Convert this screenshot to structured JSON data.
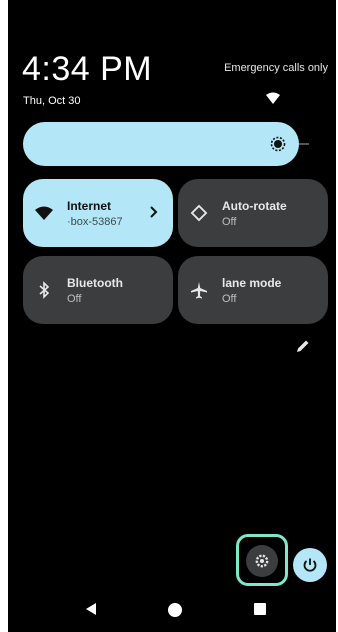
{
  "status": {
    "time": "4:34 PM",
    "date": "Thu, Oct 30",
    "network_text": "Emergency calls only"
  },
  "brightness": {
    "icon": "brightness-icon"
  },
  "tiles": [
    {
      "label": "Internet",
      "sublabel": "·box-53867",
      "icon": "wifi-icon",
      "active": true
    },
    {
      "label": "Auto-rotate",
      "sublabel": "Off",
      "icon": "rotate-icon",
      "active": false
    },
    {
      "label": "Bluetooth",
      "sublabel": "Off",
      "icon": "bluetooth-icon",
      "active": false
    },
    {
      "label": "lane mode",
      "sublabel": "Off",
      "icon": "airplane-icon",
      "active": false
    }
  ],
  "colors": {
    "accent": "#b3e7f7",
    "tile_inactive": "#3b3d3f",
    "highlight": "#7ee8c8",
    "background": "#000000"
  }
}
